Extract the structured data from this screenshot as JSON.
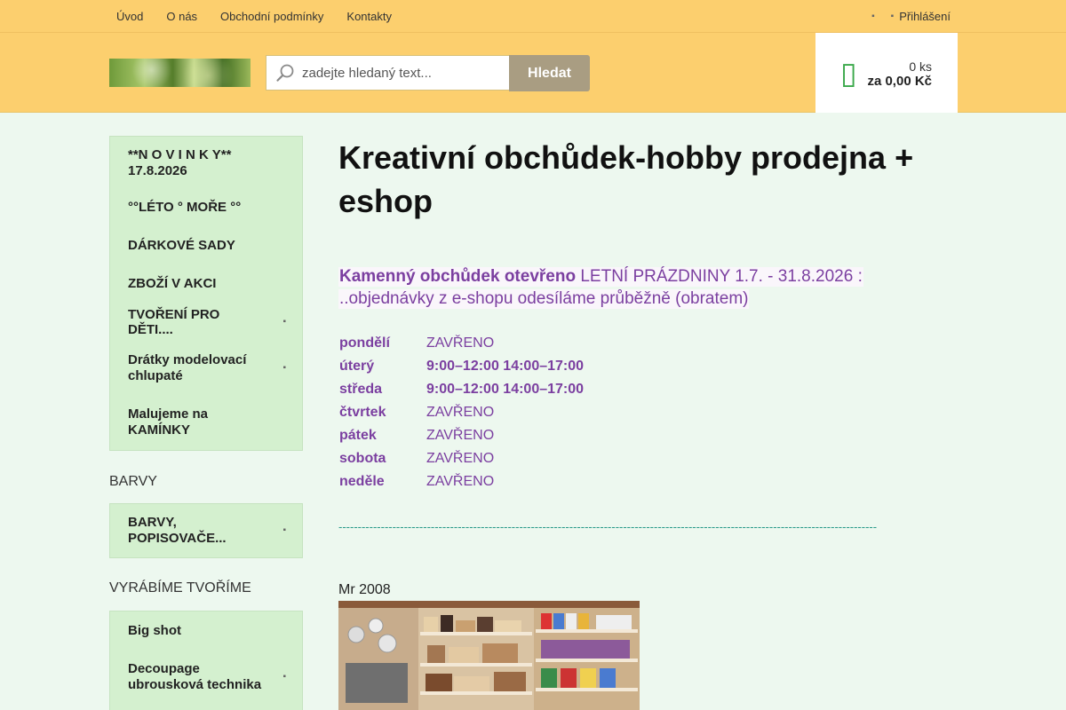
{
  "topnav": {
    "items": [
      {
        "label": "Úvod"
      },
      {
        "label": "O nás"
      },
      {
        "label": "Obchodní podmínky"
      },
      {
        "label": "Kontakty"
      }
    ],
    "login_label": "Přihlášení"
  },
  "search": {
    "placeholder": "zadejte hledaný text...",
    "button_label": "Hledat"
  },
  "cart": {
    "count": "0 ks",
    "total": "za 0,00 Kč",
    "icon": "shopping-cart-icon"
  },
  "sidebar": {
    "group1": [
      {
        "label": "**N O V I N K Y**\n17.8.2026",
        "has_submenu": false
      },
      {
        "label": "°°LÉTO ° MOŘE °°",
        "has_submenu": false
      },
      {
        "label": "DÁRKOVÉ SADY",
        "has_submenu": false
      },
      {
        "label": "ZBOŽÍ V AKCI",
        "has_submenu": false
      },
      {
        "label": "TVOŘENÍ PRO DĚTI....",
        "has_submenu": true
      },
      {
        "label": "Drátky modelovací chlupaté",
        "has_submenu": true
      },
      {
        "label": "Malujeme na KAMÍNKY",
        "has_submenu": false
      }
    ],
    "heading2": "BARVY",
    "group2": [
      {
        "label": "BARVY, POPISOVAČE...",
        "has_submenu": true
      }
    ],
    "heading3": "VYRÁBÍME TVOŘÍME",
    "group3": [
      {
        "label": "Big shot",
        "has_submenu": false
      },
      {
        "label": "Decoupage ubrousková technika",
        "has_submenu": true
      }
    ]
  },
  "main": {
    "title": "Kreativní obchůdek-hobby prodejna + eshop",
    "notice_prefix": "Kamenný obchůdek otevřeno ",
    "notice_highlight": "LETNÍ PRÁZDNINY 1.7. - 31.8.2026 :",
    "notice_line2": "..objednávky z e-shopu odesíláme průběžně (obratem)",
    "hours": [
      {
        "day": "pondělí",
        "time": "ZAVŘENO",
        "open": false
      },
      {
        "day": "úterý",
        "time": "9:00–12:00 14:00–17:00",
        "open": true
      },
      {
        "day": "středa",
        "time": "9:00–12:00 14:00–17:00",
        "open": true
      },
      {
        "day": "čtvrtek",
        "time": "ZAVŘENO",
        "open": false
      },
      {
        "day": "pátek",
        "time": "ZAVŘENO",
        "open": false
      },
      {
        "day": "sobota",
        "time": "ZAVŘENO",
        "open": false
      },
      {
        "day": "neděle",
        "time": "ZAVŘENO",
        "open": false
      }
    ],
    "divider": "--------------------------------------------------------------------------------------------------------------------------------------------",
    "photo_caption": "Mr 2008"
  },
  "colors": {
    "header_bg": "#fccf6e",
    "page_bg": "#edf8ef",
    "menu_bg": "#d4f0cf",
    "accent_purple": "#7b3fa0",
    "cart_green": "#3aa84a",
    "search_button": "#a99d82"
  }
}
